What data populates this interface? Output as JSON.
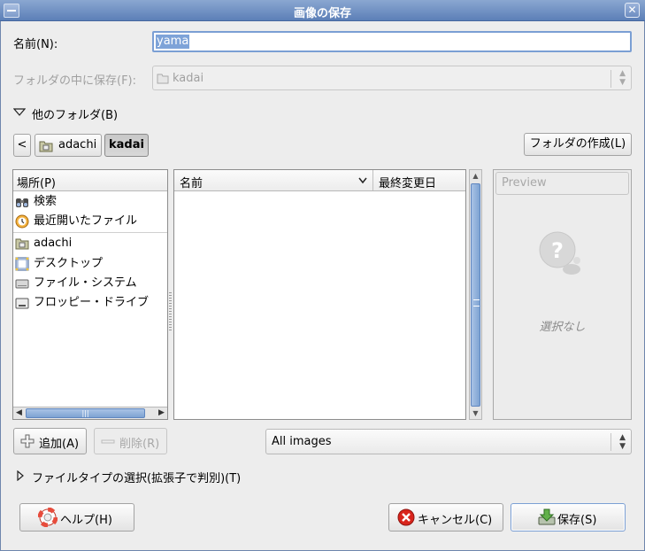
{
  "window": {
    "title": "画像の保存"
  },
  "name_row": {
    "label": "名前(N):",
    "value": "yama"
  },
  "folder_row": {
    "label": "フォルダの中に保存(F):",
    "value": "kadai"
  },
  "other_folders": {
    "label": "他のフォルダ(B)"
  },
  "path_bar": {
    "back": "<",
    "items": [
      "adachi",
      "kadai"
    ]
  },
  "create_folder_label": "フォルダの作成(L)",
  "places": {
    "header": "場所(P)",
    "items": [
      "検索",
      "最近開いたファイル",
      "adachi",
      "デスクトップ",
      "ファイル・システム",
      "フロッピー・ドライブ"
    ]
  },
  "files": {
    "col_name": "名前",
    "col_modified": "最終変更日"
  },
  "preview": {
    "button": "Preview",
    "empty": "選択なし"
  },
  "add_label": "追加(A)",
  "remove_label": "削除(R)",
  "filter": {
    "value": "All images"
  },
  "filetype": {
    "label": "ファイルタイプの選択(拡張子で判別)(T)"
  },
  "help_label": "ヘルプ(H)",
  "cancel_label": "キャンセル(C)",
  "save_label": "保存(S)",
  "colors": {
    "titlebar": "#6f8fc3",
    "selection": "#7ea3d8",
    "scrollbar": "#7ea3d2"
  }
}
